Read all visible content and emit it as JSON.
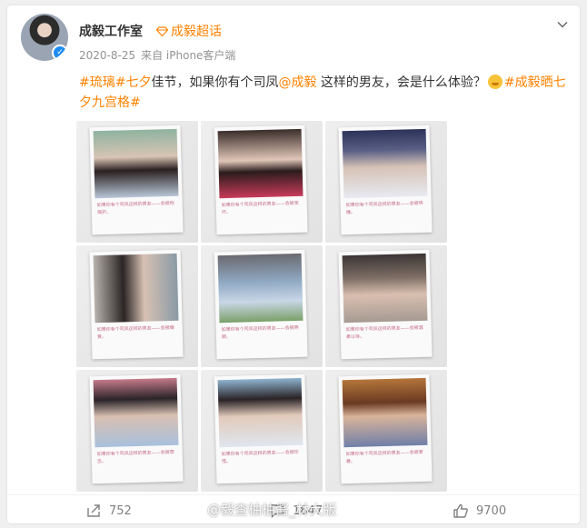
{
  "post": {
    "author": "成毅工作室",
    "super_topic": "成毅超话",
    "date": "2020-8-25",
    "source": "来自 iPhone客户端",
    "text": {
      "tag1": "#琉璃#",
      "tag2": "七夕",
      "t1": "佳节，如果你有个司凤",
      "mention": "@成毅",
      "t2": " 这样的男友，会是什么体验？",
      "tag3": "#成毅晒七夕九宫格#"
    },
    "captions": [
      "如果你有个司凤这样的男友——会被他保护。",
      "如果你有个司凤这样的男友——会被宠坏。",
      "如果你有个司凤这样的男友——会被哄睡。",
      "如果你有个司凤这样的男友——会被偏爱。",
      "如果你有个司凤这样的男友——会被照顾。",
      "如果你有个司凤这样的男友——会被温柔以待。",
      "如果你有个司凤这样的男友——会被想念。",
      "如果你有个司凤这样的男友——会被珍惜。",
      "如果你有个司凤这样的男友——会被爱着。"
    ]
  },
  "stats": {
    "reposts": "752",
    "comments": "1647",
    "likes": "9700"
  },
  "watermark": "@毅查柚柚酱_林大版",
  "colors": {
    "accent": "#ff8200",
    "verified": "#1e8cf0",
    "caption": "#c46a86"
  }
}
